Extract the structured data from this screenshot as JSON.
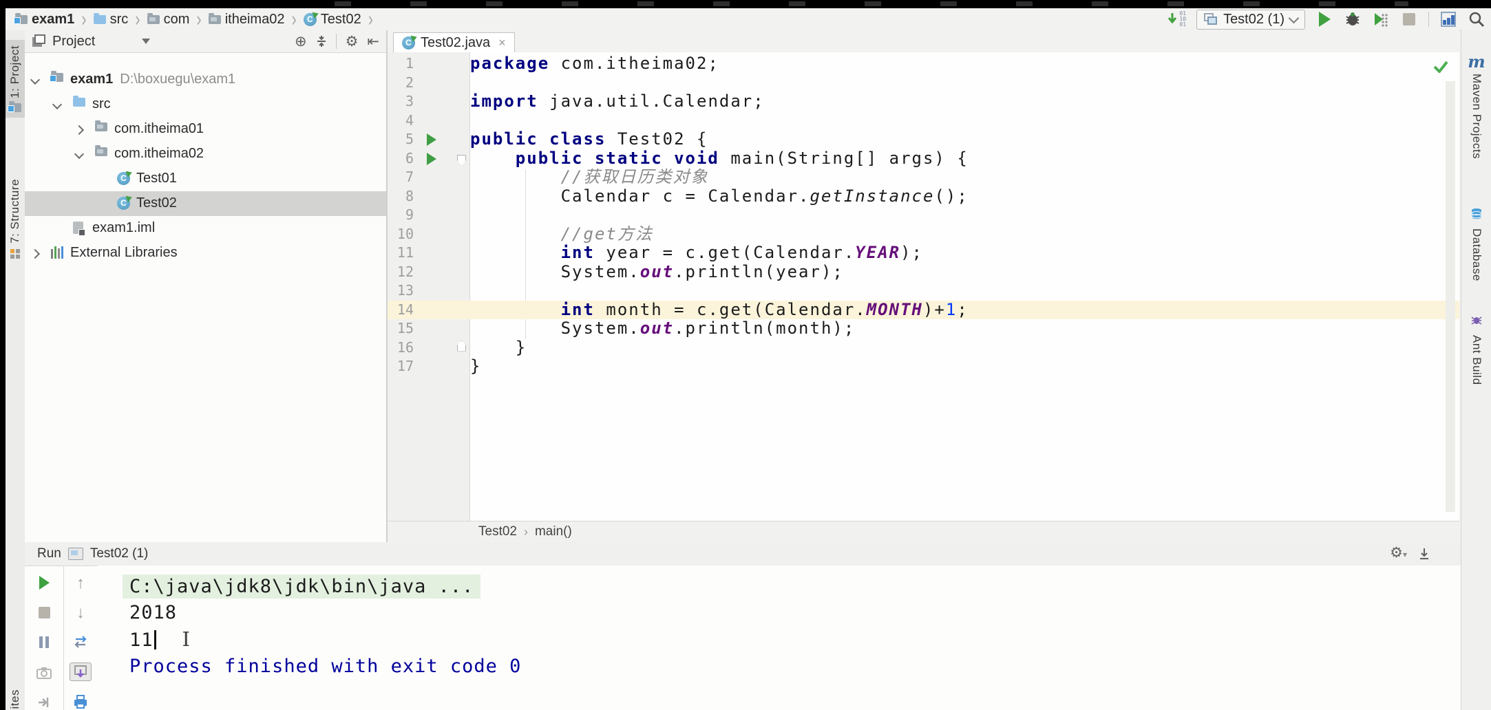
{
  "topbar": {
    "breadcrumbs": [
      {
        "label": "exam1",
        "icon": "project-folder",
        "bold": true
      },
      {
        "label": "src",
        "icon": "folder-blue"
      },
      {
        "label": "com",
        "icon": "folder-gray"
      },
      {
        "label": "itheima02",
        "icon": "folder-gray"
      },
      {
        "label": "Test02",
        "icon": "class"
      }
    ],
    "update_digits": [
      "01",
      "10",
      "01"
    ],
    "run_config": {
      "label": "Test02 (1)"
    }
  },
  "left_stripe": {
    "items": [
      {
        "label": "1: Project",
        "icon": "project-tool",
        "active": true
      },
      {
        "label": "7: Structure",
        "icon": "structure-tool",
        "active": false
      }
    ],
    "bottom_label": "ites"
  },
  "right_stripe": {
    "items": [
      {
        "label": "Maven Projects",
        "icon": "maven"
      },
      {
        "label": "Database",
        "icon": "database"
      },
      {
        "label": "Ant Build",
        "icon": "ant"
      }
    ]
  },
  "project": {
    "title": "Project",
    "tree": [
      {
        "label": "exam1",
        "suffix": "D:\\boxuegu\\exam1",
        "icon": "project-folder",
        "chevron": "down",
        "level": 0,
        "bold": true,
        "selected": false
      },
      {
        "label": "src",
        "icon": "folder-blue",
        "chevron": "down",
        "level": 1,
        "selected": false
      },
      {
        "label": "com.itheima01",
        "icon": "folder-gray",
        "chevron": "right",
        "level": 2,
        "selected": false
      },
      {
        "label": "com.itheima02",
        "icon": "folder-gray",
        "chevron": "down",
        "level": 2,
        "selected": false
      },
      {
        "label": "Test01",
        "icon": "class",
        "level": 3,
        "selected": false
      },
      {
        "label": "Test02",
        "icon": "class",
        "level": 3,
        "selected": true
      },
      {
        "label": "exam1.iml",
        "icon": "iml-file",
        "level": 1,
        "selected": false
      },
      {
        "label": "External Libraries",
        "icon": "libraries",
        "chevron": "right",
        "level": 0,
        "selected": false
      }
    ]
  },
  "editor": {
    "tab": "Test02.java",
    "breadcrumb": [
      "Test02",
      "main()"
    ],
    "lines": [
      {
        "n": 1,
        "segs": [
          [
            "kw",
            "package"
          ],
          [
            "pl",
            " com.itheima02;"
          ]
        ]
      },
      {
        "n": 2,
        "segs": []
      },
      {
        "n": 3,
        "segs": [
          [
            "kw",
            "import"
          ],
          [
            "pl",
            " java.util.Calendar;"
          ]
        ]
      },
      {
        "n": 4,
        "segs": []
      },
      {
        "n": 5,
        "run": true,
        "segs": [
          [
            "kw",
            "public class"
          ],
          [
            "pl",
            " Test02 {"
          ]
        ]
      },
      {
        "n": 6,
        "run": true,
        "fold": "open",
        "segs": [
          [
            "pl",
            "    "
          ],
          [
            "kw",
            "public static void"
          ],
          [
            "pl",
            " main(String[] args) {"
          ]
        ]
      },
      {
        "n": 7,
        "segs": [
          [
            "pl",
            "        "
          ],
          [
            "cm",
            "//获取日历类对象"
          ]
        ]
      },
      {
        "n": 8,
        "segs": [
          [
            "pl",
            "        "
          ],
          [
            "pl",
            "Calendar c = Calendar."
          ],
          [
            "sm",
            "getInstance"
          ],
          [
            "pl",
            "();"
          ]
        ]
      },
      {
        "n": 9,
        "segs": []
      },
      {
        "n": 10,
        "segs": [
          [
            "pl",
            "        "
          ],
          [
            "cm",
            "//get方法"
          ]
        ]
      },
      {
        "n": 11,
        "segs": [
          [
            "pl",
            "        "
          ],
          [
            "kw",
            "int"
          ],
          [
            "pl",
            " year = c.get(Calendar."
          ],
          [
            "sf",
            "YEAR"
          ],
          [
            "pl",
            ");"
          ]
        ]
      },
      {
        "n": 12,
        "segs": [
          [
            "pl",
            "        "
          ],
          [
            "pl",
            "System."
          ],
          [
            "sf",
            "out"
          ],
          [
            "pl",
            ".println(year);"
          ]
        ]
      },
      {
        "n": 13,
        "segs": []
      },
      {
        "n": 14,
        "hl": true,
        "segs": [
          [
            "pl",
            "        "
          ],
          [
            "kw",
            "int"
          ],
          [
            "pl",
            " month = c.get(Calendar."
          ],
          [
            "sf",
            "MONTH"
          ],
          [
            "pl",
            ")+"
          ],
          [
            "num",
            "1"
          ],
          [
            "pl",
            ";"
          ]
        ]
      },
      {
        "n": 15,
        "segs": [
          [
            "pl",
            "        "
          ],
          [
            "pl",
            "System."
          ],
          [
            "sf",
            "out"
          ],
          [
            "pl",
            ".println(month);"
          ]
        ]
      },
      {
        "n": 16,
        "fold": "close",
        "segs": [
          [
            "pl",
            "    "
          ],
          [
            "pl",
            "}"
          ]
        ]
      },
      {
        "n": 17,
        "segs": [
          [
            "pl",
            "}"
          ]
        ]
      }
    ]
  },
  "run": {
    "label": "Run",
    "tab": "Test02 (1)",
    "console": [
      {
        "style": "cmd",
        "text": "C:\\java\\jdk8\\jdk\\bin\\java ...",
        "caret": false,
        "ibeam": false
      },
      {
        "style": "plain",
        "text": "2018",
        "caret": false,
        "ibeam": false
      },
      {
        "style": "plain",
        "text": "11",
        "caret": true,
        "ibeam": true
      },
      {
        "style": "plain",
        "text": "",
        "caret": false,
        "ibeam": false
      },
      {
        "style": "exit",
        "text": "Process finished with exit code 0",
        "caret": false,
        "ibeam": false
      }
    ]
  },
  "colors": {
    "keyword": "#000080",
    "comment": "#8a8a8a",
    "static_member": "#660e7a",
    "number": "#0038ff",
    "run_green": "#3fa13f",
    "line_highlight": "#fbf4da",
    "cmd_highlight": "#e3f0df",
    "exit_text": "#00009c",
    "selection_gray": "#d3d3d2"
  }
}
